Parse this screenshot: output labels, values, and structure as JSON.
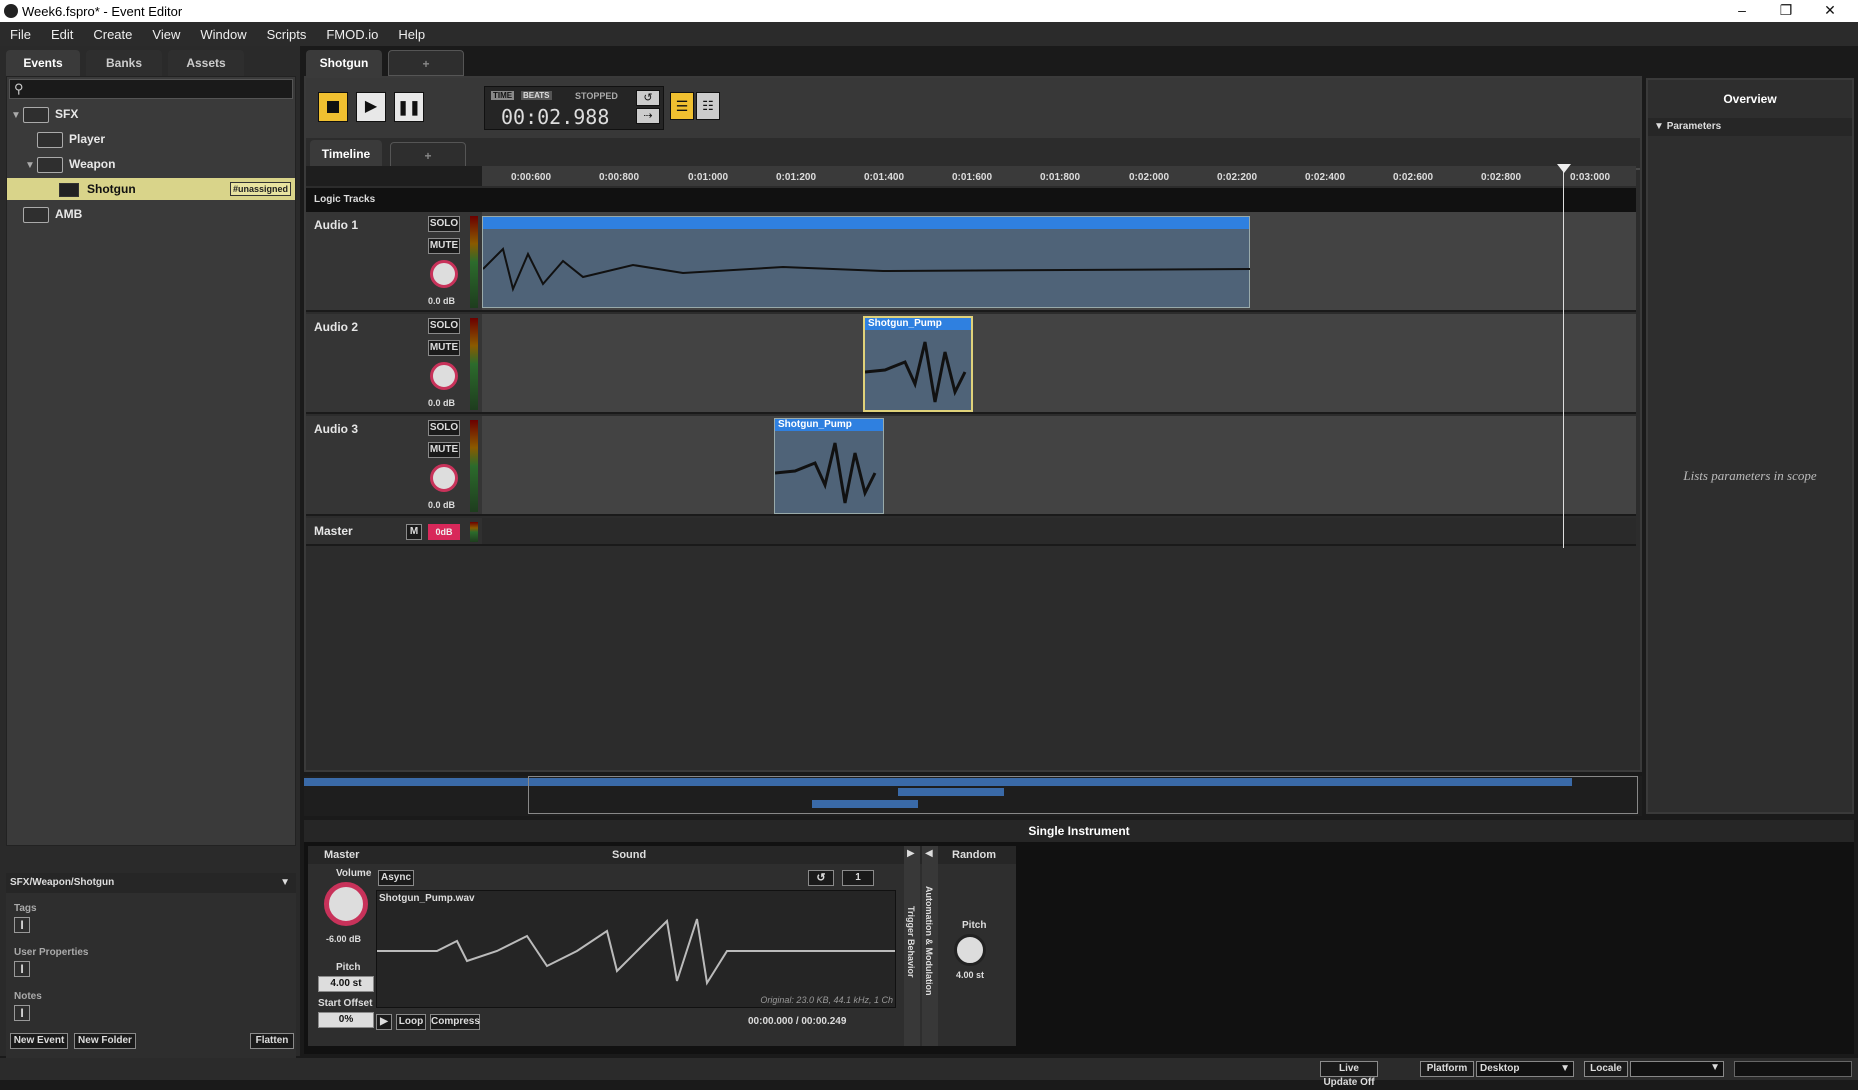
{
  "window": {
    "title": "Week6.fspro* - Event Editor"
  },
  "menu": [
    "File",
    "Edit",
    "Create",
    "View",
    "Window",
    "Scripts",
    "FMOD.io",
    "Help"
  ],
  "browser": {
    "tabs": [
      "Events",
      "Banks",
      "Assets"
    ],
    "tree": [
      {
        "label": "SFX"
      },
      {
        "label": "Player"
      },
      {
        "label": "Weapon"
      },
      {
        "label": "Shotgun",
        "badge": "#unassigned"
      },
      {
        "label": "AMB"
      }
    ],
    "path": "SFX/Weapon/Shotgun",
    "props": [
      "Tags",
      "User Properties",
      "Notes"
    ],
    "footer": {
      "new_event": "New Event",
      "new_folder": "New Folder",
      "flatten": "Flatten"
    }
  },
  "editor": {
    "event_tab": "Shotgun",
    "add_tab": "+",
    "transport": {
      "time_label": "TIME",
      "beats_label": "BEATS",
      "status": "STOPPED",
      "time": "00:02.988"
    },
    "timeline_tab": "Timeline",
    "ruler": [
      "0:00:600",
      "0:00:800",
      "0:01:000",
      "0:01:200",
      "0:01:400",
      "0:01:600",
      "0:01:800",
      "0:02:000",
      "0:02:200",
      "0:02:400",
      "0:02:600",
      "0:02:800",
      "0:03:000"
    ],
    "logic_tracks": "Logic Tracks",
    "tracks": [
      {
        "name": "Audio 1",
        "solo": "SOLO",
        "mute": "MUTE",
        "vol": "0.0 dB"
      },
      {
        "name": "Audio 2",
        "solo": "SOLO",
        "mute": "MUTE",
        "vol": "0.0 dB",
        "region": "Shotgun_Pump"
      },
      {
        "name": "Audio 3",
        "solo": "SOLO",
        "mute": "MUTE",
        "vol": "0.0 dB",
        "region": "Shotgun_Pump"
      }
    ],
    "master": {
      "name": "Master",
      "m": "M",
      "vol": "0dB"
    }
  },
  "overview": {
    "title": "Overview",
    "parameters": "Parameters",
    "empty": "Lists parameters in scope"
  },
  "deck": {
    "title": "Single Instrument",
    "master": {
      "label": "Master",
      "volume_label": "Volume",
      "volume": "-6.00 dB",
      "pitch_label": "Pitch",
      "pitch": "4.00 st",
      "offset_label": "Start Offset",
      "offset": "0%"
    },
    "sound": {
      "label": "Sound",
      "async": "Async",
      "count": "1",
      "file": "Shotgun_Pump.wav",
      "info": "Original: 23.0 KB, 44.1 kHz, 1 Ch",
      "loop": "Loop",
      "compress": "Compress",
      "range": "00:00.000 / 00:00.249"
    },
    "trigger": "Trigger Behavior",
    "automation": "Automation & Modulation",
    "random": {
      "label": "Random",
      "pitch_label": "Pitch",
      "pitch": "4.00 st"
    }
  },
  "statusbar": {
    "live_update": "Live Update Off",
    "platform_label": "Platform",
    "platform": "Desktop",
    "locale_label": "Locale"
  }
}
